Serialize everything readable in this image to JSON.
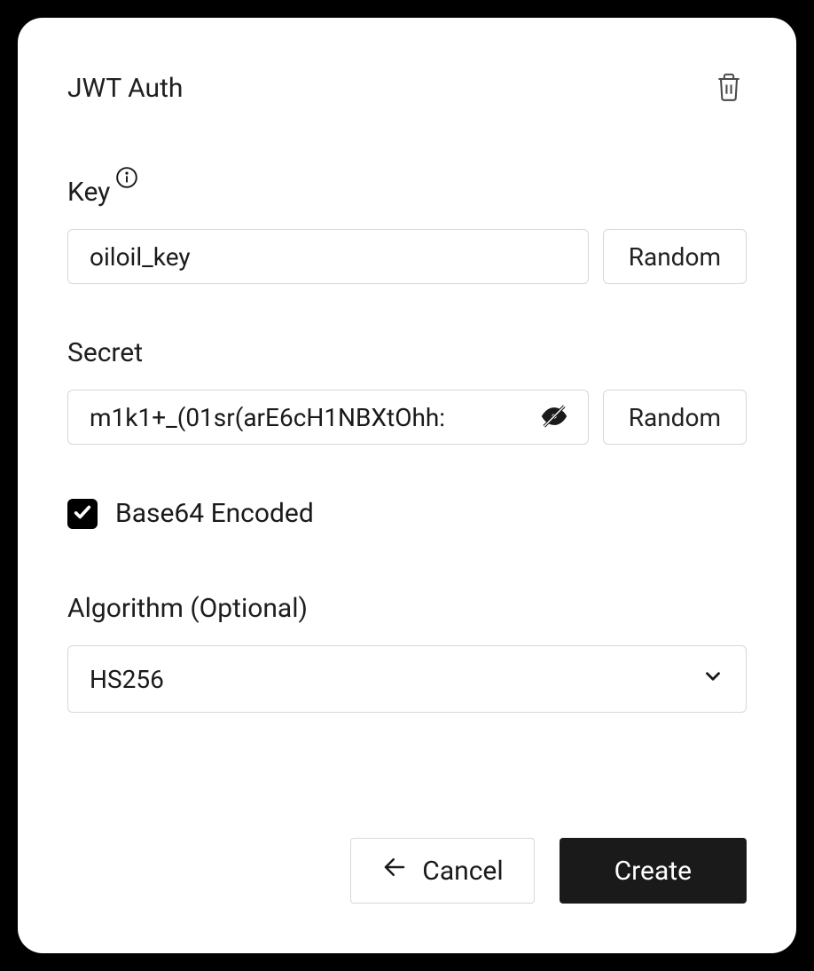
{
  "header": {
    "title": "JWT Auth"
  },
  "key": {
    "label": "Key",
    "value": "oiloil_key",
    "random_label": "Random"
  },
  "secret": {
    "label": "Secret",
    "value": "m1k1+_(01sr(arE6cH1NBXtOhh:",
    "random_label": "Random"
  },
  "base64": {
    "label": "Base64 Encoded",
    "checked": true
  },
  "algorithm": {
    "label": "Algorithm (Optional)",
    "value": "HS256"
  },
  "footer": {
    "cancel_label": "Cancel",
    "create_label": "Create"
  }
}
